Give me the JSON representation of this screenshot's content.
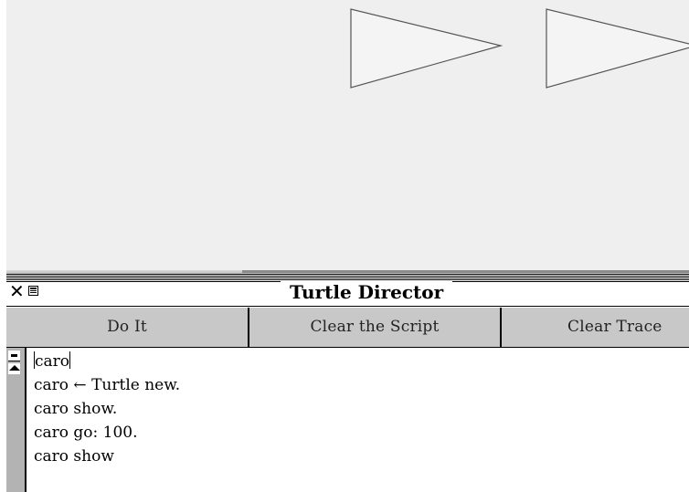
{
  "window": {
    "title": "Turtle Director"
  },
  "buttons": {
    "do_it": "Do It",
    "clear_script": "Clear the Script",
    "clear_trace": "Clear Trace"
  },
  "script": {
    "lines": [
      "caro",
      "caro ← Turtle new.",
      "caro show.",
      "caro go: 100.",
      "caro show"
    ]
  },
  "icons": {
    "close": "close-icon",
    "collapse": "collapse-icon",
    "scroll_up": "scroll-up-icon",
    "scroll_top": "scroll-top-icon",
    "turtle": "turtle-triangle-icon"
  },
  "colors": {
    "canvas_bg": "#efefef",
    "buttonbar_bg": "#c8c8c8",
    "scrollbar_bg": "#b3b3b3",
    "turtle_stroke": "#555555"
  }
}
